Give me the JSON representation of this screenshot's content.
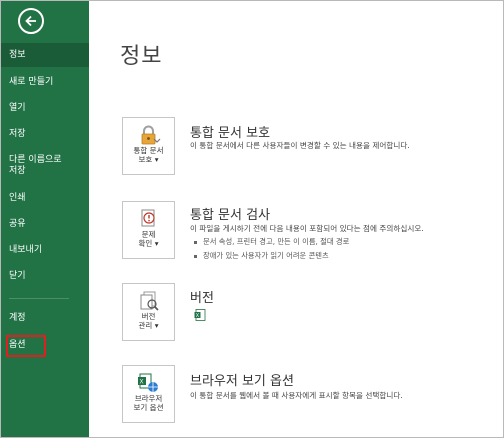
{
  "sidebar": {
    "items": [
      {
        "label": "정보"
      },
      {
        "label": "새로 만들기"
      },
      {
        "label": "열기"
      },
      {
        "label": "저장"
      },
      {
        "label_line1": "다른 이름으로",
        "label_line2": "저장"
      },
      {
        "label": "인쇄"
      },
      {
        "label": "공유"
      },
      {
        "label": "내보내기"
      },
      {
        "label": "닫기"
      },
      {
        "label": "계정"
      },
      {
        "label": "옵션"
      }
    ]
  },
  "main": {
    "title": "정보",
    "sections": [
      {
        "tile_line1": "통합 문서",
        "tile_line2": "보호",
        "title": "통합 문서 보호",
        "desc": "이 통합 문서에서 다른 사용자들이 변경할 수 있는 내용을 제어합니다."
      },
      {
        "tile_line1": "문제",
        "tile_line2": "확인",
        "title": "통합 문서 검사",
        "desc": "이 파일을 게시하기 전에 다음 내용이 포함되어 있다는 점에 주의하십시오.",
        "bullets": [
          "문서 속성, 프린터 경고, 만든 이 이름, 절대 경로",
          "장애가 있는 사용자가 읽기 어려운 콘텐츠"
        ]
      },
      {
        "tile_line1": "버전",
        "tile_line2": "관리",
        "title": "버전"
      },
      {
        "tile_line1": "브라우저",
        "tile_line2": "보기 옵션",
        "title": "브라우저 보기 옵션",
        "desc": "이 통합 문서를 웹에서 볼 때 사용자에게 표시할 항목을 선택합니다."
      }
    ]
  },
  "colors": {
    "sidebar": "#217346",
    "active": "#1a5c38",
    "highlight": "#e02020"
  },
  "icons": [
    "back-arrow-icon",
    "lock-icon",
    "inspect-document-icon",
    "versions-icon",
    "excel-file-icon",
    "browser-options-icon"
  ]
}
